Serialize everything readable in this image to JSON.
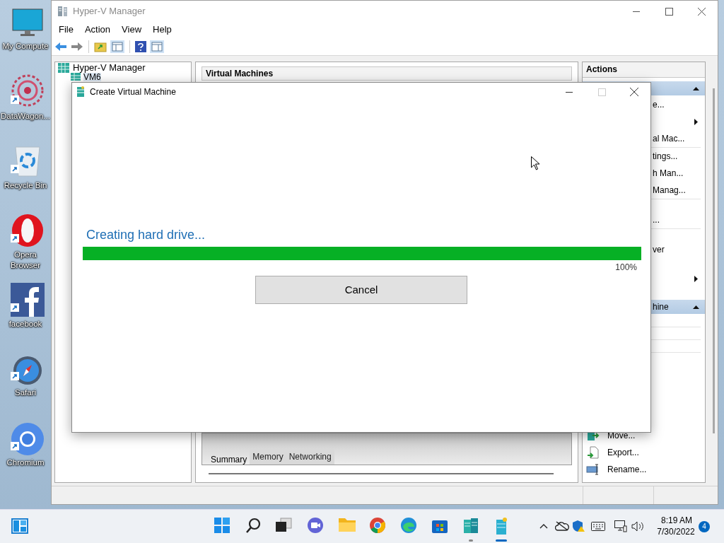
{
  "desktop_icons": [
    {
      "label": "My Compute"
    },
    {
      "label": "DataWagon..."
    },
    {
      "label": "Recycle Bin"
    },
    {
      "label": "Opera Browser"
    },
    {
      "label": "facebook"
    },
    {
      "label": "Safari"
    },
    {
      "label": "Chromium"
    }
  ],
  "manager": {
    "title": "Hyper-V Manager",
    "menu": [
      "File",
      "Action",
      "View",
      "Help"
    ],
    "tree": {
      "label": "Hyper-V Manager",
      "children": [
        {
          "label": "VM6"
        }
      ]
    },
    "center_title": "Virtual Machines",
    "tabs": [
      {
        "label": "Summary",
        "selected": true
      },
      {
        "label": "Memory",
        "selected": false
      },
      {
        "label": "Networking",
        "selected": false
      }
    ],
    "actions": {
      "title": "Actions",
      "items": [
        {
          "kind": "header"
        },
        {
          "kind": "row",
          "label": "e..."
        },
        {
          "kind": "submenu"
        },
        {
          "kind": "row",
          "label": "al Mac..."
        },
        {
          "kind": "separator"
        },
        {
          "kind": "row",
          "label": "tings..."
        },
        {
          "kind": "row",
          "label": "h Man..."
        },
        {
          "kind": "row",
          "label": "Manag..."
        },
        {
          "kind": "separator"
        },
        {
          "kind": "blank"
        },
        {
          "kind": "row",
          "label": "..."
        },
        {
          "kind": "separator"
        },
        {
          "kind": "blank"
        },
        {
          "kind": "row",
          "label": "ver"
        },
        {
          "kind": "blank"
        },
        {
          "kind": "submenu"
        },
        {
          "kind": "blank"
        },
        {
          "kind": "header",
          "label": "hine"
        },
        {
          "kind": "blank"
        },
        {
          "kind": "separator"
        },
        {
          "kind": "blank"
        },
        {
          "kind": "separator"
        },
        {
          "kind": "blank"
        },
        {
          "kind": "separator"
        },
        {
          "kind": "blank"
        },
        {
          "kind": "blank"
        },
        {
          "kind": "action",
          "label": "Move..."
        },
        {
          "kind": "action",
          "label": "Export..."
        },
        {
          "kind": "action",
          "label": "Rename..."
        }
      ]
    }
  },
  "dialog": {
    "title": "Create Virtual Machine",
    "message": "Creating hard drive...",
    "progress": {
      "level": 1.0,
      "reading": "100%"
    },
    "button": "Cancel"
  },
  "taskbar": {
    "apps": [
      {
        "open": false,
        "selected": false
      },
      {
        "open": false,
        "selected": false
      },
      {
        "open": false,
        "selected": false
      },
      {
        "open": false,
        "selected": false
      },
      {
        "open": false,
        "selected": false
      },
      {
        "open": false,
        "selected": false
      },
      {
        "open": false,
        "selected": false
      },
      {
        "open": false,
        "selected": false
      },
      {
        "open": true,
        "selected": false
      },
      {
        "open": true,
        "selected": true
      }
    ],
    "time": "8:19 AM",
    "date": "7/30/2022",
    "notifications": "4"
  }
}
